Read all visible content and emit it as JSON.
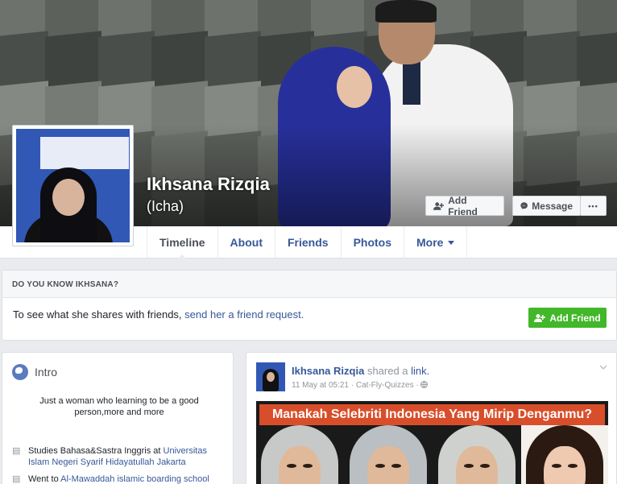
{
  "profile": {
    "name": "Ikhsana Rizqia",
    "alternate_name": "(Icha)"
  },
  "cover_buttons": {
    "add_friend": "Add Friend",
    "message": "Message",
    "more": "•••"
  },
  "tabs": [
    {
      "label": "Timeline",
      "active": true
    },
    {
      "label": "About"
    },
    {
      "label": "Friends"
    },
    {
      "label": "Photos"
    },
    {
      "label": "More"
    }
  ],
  "know_box": {
    "heading": "DO YOU KNOW IKHSANA?",
    "text": "To see what she shares with friends, ",
    "link": "send her a friend request.",
    "button": "Add Friend"
  },
  "intro": {
    "title": "Intro",
    "bio": "Just a woman who learning to be a good person,more and more",
    "studies_prefix": "Studies Bahasa&Sastra Inggris at ",
    "studies_link": "Universitas Islam Negeri Syarif Hidayatullah Jakarta",
    "went_prefix": "Went to ",
    "went_link": "Al-Mawaddah islamic boarding school"
  },
  "post": {
    "author": "Ikhsana Rizqia",
    "action": "shared a ",
    "action_link": "link.",
    "time": "11 May at 05:21",
    "separator": "·",
    "source": "Cat-Fly-Quizzes",
    "link_title": "Manakah Selebriti Indonesia Yang Mirip Denganmu?"
  },
  "colors": {
    "link_blue": "#365899",
    "green_button": "#42b72a",
    "page_bg": "#e9ebee"
  }
}
